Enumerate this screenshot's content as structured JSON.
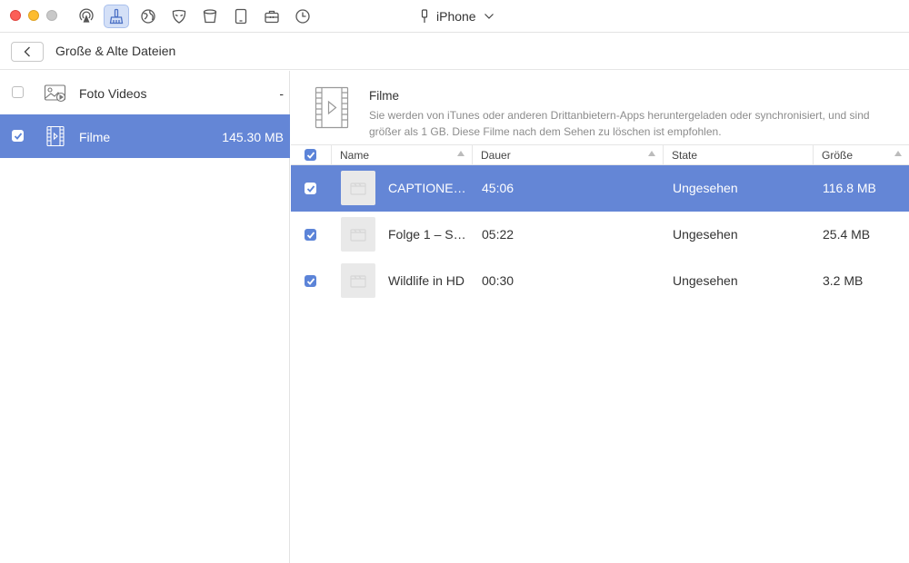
{
  "device": {
    "name": "iPhone"
  },
  "toolbar": {
    "tools": [
      "airplay-icon",
      "cleaner-icon",
      "globe-icon",
      "mask-icon",
      "bucket-icon",
      "tablet-icon",
      "toolbox-icon",
      "history-icon"
    ],
    "active_tool": "cleaner-icon"
  },
  "header": {
    "title": "Große & Alte Dateien"
  },
  "sidebar": {
    "items": [
      {
        "label": "Foto Videos",
        "size": "-",
        "checked": false,
        "selected": false,
        "icon": "photo-video-icon"
      },
      {
        "label": "Filme",
        "size": "145.30 MB",
        "checked": true,
        "selected": true,
        "icon": "film-icon"
      }
    ]
  },
  "category": {
    "title": "Filme",
    "description": "Sie werden von iTunes oder anderen Drittanbietern-Apps heruntergeladen oder synchronisiert, und sind größer als 1 GB. Diese Filme nach dem Sehen zu löschen ist empfohlen."
  },
  "table": {
    "columns": [
      "Name",
      "Dauer",
      "State",
      "Größe"
    ],
    "rows": [
      {
        "name": "CAPTIONE…",
        "duration": "45:06",
        "state": "Ungesehen",
        "size": "116.8 MB",
        "checked": true,
        "selected": true
      },
      {
        "name": "Folge 1 – S…",
        "duration": "05:22",
        "state": "Ungesehen",
        "size": "25.4 MB",
        "checked": true,
        "selected": false
      },
      {
        "name": "Wildlife in HD",
        "duration": "00:30",
        "state": "Ungesehen",
        "size": "3.2 MB",
        "checked": true,
        "selected": false
      }
    ]
  },
  "colors": {
    "accent": "#6486d6",
    "checkbox": "#5c84d8"
  }
}
